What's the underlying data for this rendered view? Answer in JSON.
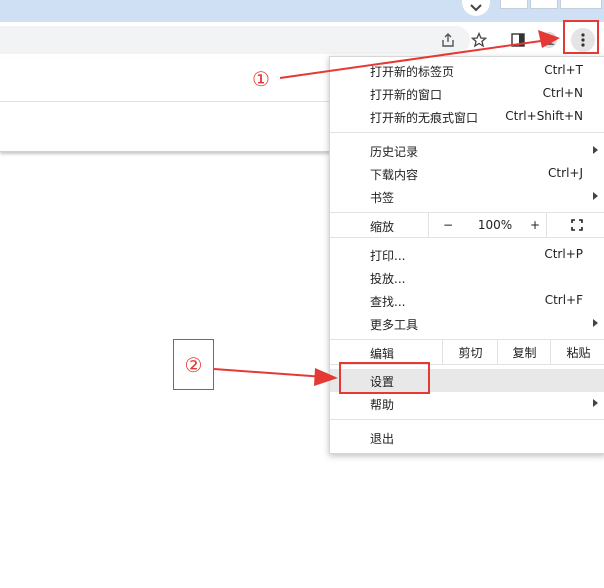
{
  "menu": {
    "new_tab": {
      "label": "打开新的标签页",
      "shortcut": "Ctrl+T"
    },
    "new_window": {
      "label": "打开新的窗口",
      "shortcut": "Ctrl+N"
    },
    "new_incognito": {
      "label": "打开新的无痕式窗口",
      "shortcut": "Ctrl+Shift+N"
    },
    "history": {
      "label": "历史记录"
    },
    "downloads": {
      "label": "下载内容",
      "shortcut": "Ctrl+J"
    },
    "bookmarks": {
      "label": "书签"
    },
    "zoom": {
      "label": "缩放",
      "minus": "−",
      "value": "100%",
      "plus": "+"
    },
    "print": {
      "label": "打印...",
      "shortcut": "Ctrl+P"
    },
    "cast": {
      "label": "投放..."
    },
    "find": {
      "label": "查找...",
      "shortcut": "Ctrl+F"
    },
    "more_tools": {
      "label": "更多工具"
    },
    "edit": {
      "label": "编辑",
      "cut": "剪切",
      "copy": "复制",
      "paste": "粘贴"
    },
    "settings": {
      "label": "设置"
    },
    "help": {
      "label": "帮助"
    },
    "exit": {
      "label": "退出"
    }
  },
  "annotations": {
    "marker1": "①",
    "marker2": "②",
    "color": "#e53935"
  },
  "icons": [
    "chevron-down-icon",
    "share-icon",
    "star-icon",
    "side-panel-icon",
    "profile-icon",
    "more-vert-icon",
    "fullscreen-icon"
  ]
}
